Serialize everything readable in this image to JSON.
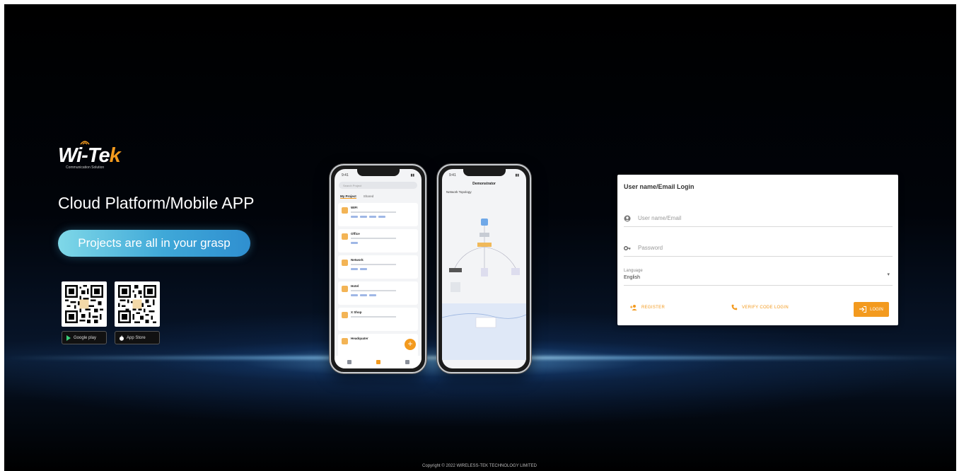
{
  "brand": {
    "logo_text_main": "Wi-Te",
    "logo_text_accent": "k",
    "logo_tagline": "Communication Solution",
    "headline": "Cloud Platform/Mobile APP",
    "slogan": "Projects are all in your grasp"
  },
  "downloads": {
    "google_play_label": "Google play",
    "app_store_label": "App Store"
  },
  "phone_left": {
    "status_time": "9:41",
    "search_placeholder": "Search Project",
    "tabs": [
      "My Project",
      "Shared"
    ],
    "projects": [
      {
        "name": "WIFI"
      },
      {
        "name": "Office"
      },
      {
        "name": "Network"
      },
      {
        "name": "Hotel"
      },
      {
        "name": "X Shop"
      },
      {
        "name": "Headquater"
      }
    ],
    "fab": "+"
  },
  "phone_right": {
    "status_time": "9:41",
    "title": "Demonstrator",
    "section": "Network Topology"
  },
  "login": {
    "title": "User name/Email Login",
    "username_placeholder": "User name/Email",
    "password_placeholder": "Password",
    "language_label": "Language",
    "language_value": "English",
    "register_label": "REGISTER",
    "verify_code_label": "VERIFY CODE LOGIN",
    "login_label": "LOGIN",
    "accent_color": "#f39a1e"
  },
  "footer": {
    "copyright": "Copyright © 2022 WIRELESS-TEK TECHNOLOGY LIMITED"
  }
}
